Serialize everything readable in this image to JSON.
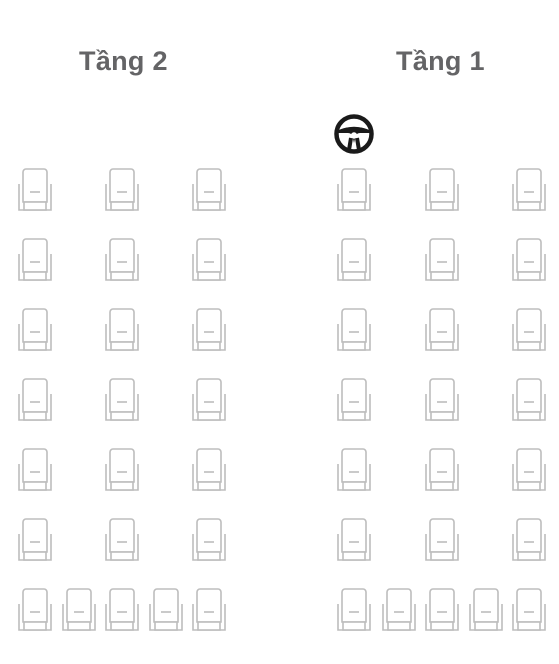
{
  "decks": {
    "upper": {
      "title": "Tầng 2"
    },
    "lower": {
      "title": "Tầng 1"
    }
  },
  "driver": {
    "icon": "steering-wheel-icon"
  },
  "seat_icon": "seat-icon",
  "colors": {
    "title": "#646466",
    "seat_outline": "#bdbdbd",
    "wheel": "#1a1a1a",
    "background": "#ffffff"
  },
  "layout": {
    "seat_rows_per_deck": 7,
    "regular_row_seats": 3,
    "back_row_seats": 5
  }
}
